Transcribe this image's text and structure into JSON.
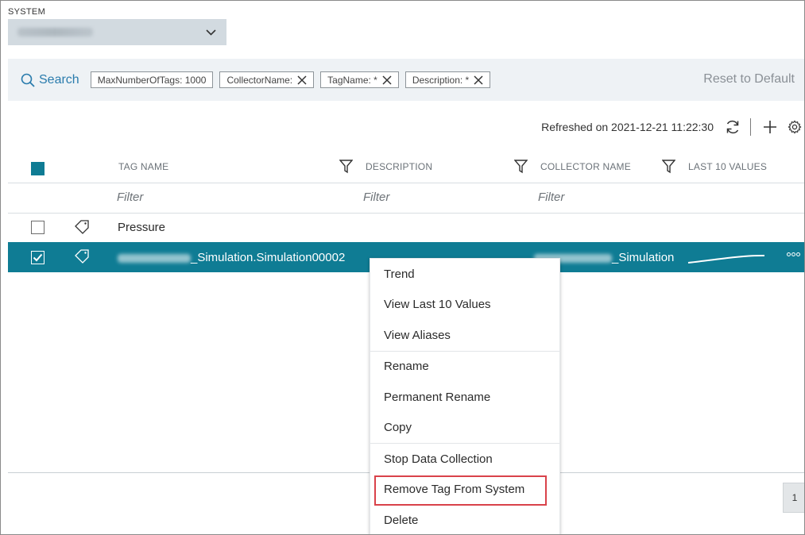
{
  "system": {
    "label": "SYSTEM",
    "selected": ""
  },
  "search": {
    "label": "Search",
    "chips": [
      {
        "text": "MaxNumberOfTags: 1000",
        "removable": false
      },
      {
        "text": "CollectorName:",
        "removable": true
      },
      {
        "text": "TagName: *",
        "removable": true
      },
      {
        "text": "Description: *",
        "removable": true
      }
    ],
    "reset_label": "Reset to Default"
  },
  "toolbar": {
    "refreshed": "Refreshed on 2021-12-21 11:22:30",
    "icons": [
      "refresh-icon",
      "plus-icon",
      "gear-icon"
    ]
  },
  "table": {
    "columns": [
      "TAG NAME",
      "DESCRIPTION",
      "COLLECTOR NAME",
      "LAST 10 VALUES"
    ],
    "filter_placeholder": "Filter",
    "rows": [
      {
        "checked": false,
        "tag_name": "Pressure",
        "description": "",
        "collector": ""
      },
      {
        "checked": true,
        "tag_name": "_Simulation.Simulation00002",
        "description": "",
        "collector": "_Simulation"
      }
    ],
    "highlight_color": "#0f7c94"
  },
  "context_menu": {
    "groups": [
      [
        "Trend",
        "View Last 10 Values",
        "View Aliases"
      ],
      [
        "Rename",
        "Permanent Rename",
        "Copy"
      ],
      [
        "Stop Data Collection",
        "Remove Tag From System",
        "Delete"
      ]
    ],
    "highlighted_item": "Remove Tag From System",
    "highlight_color": "#d9424a"
  },
  "pagination": {
    "current_page": "1"
  }
}
